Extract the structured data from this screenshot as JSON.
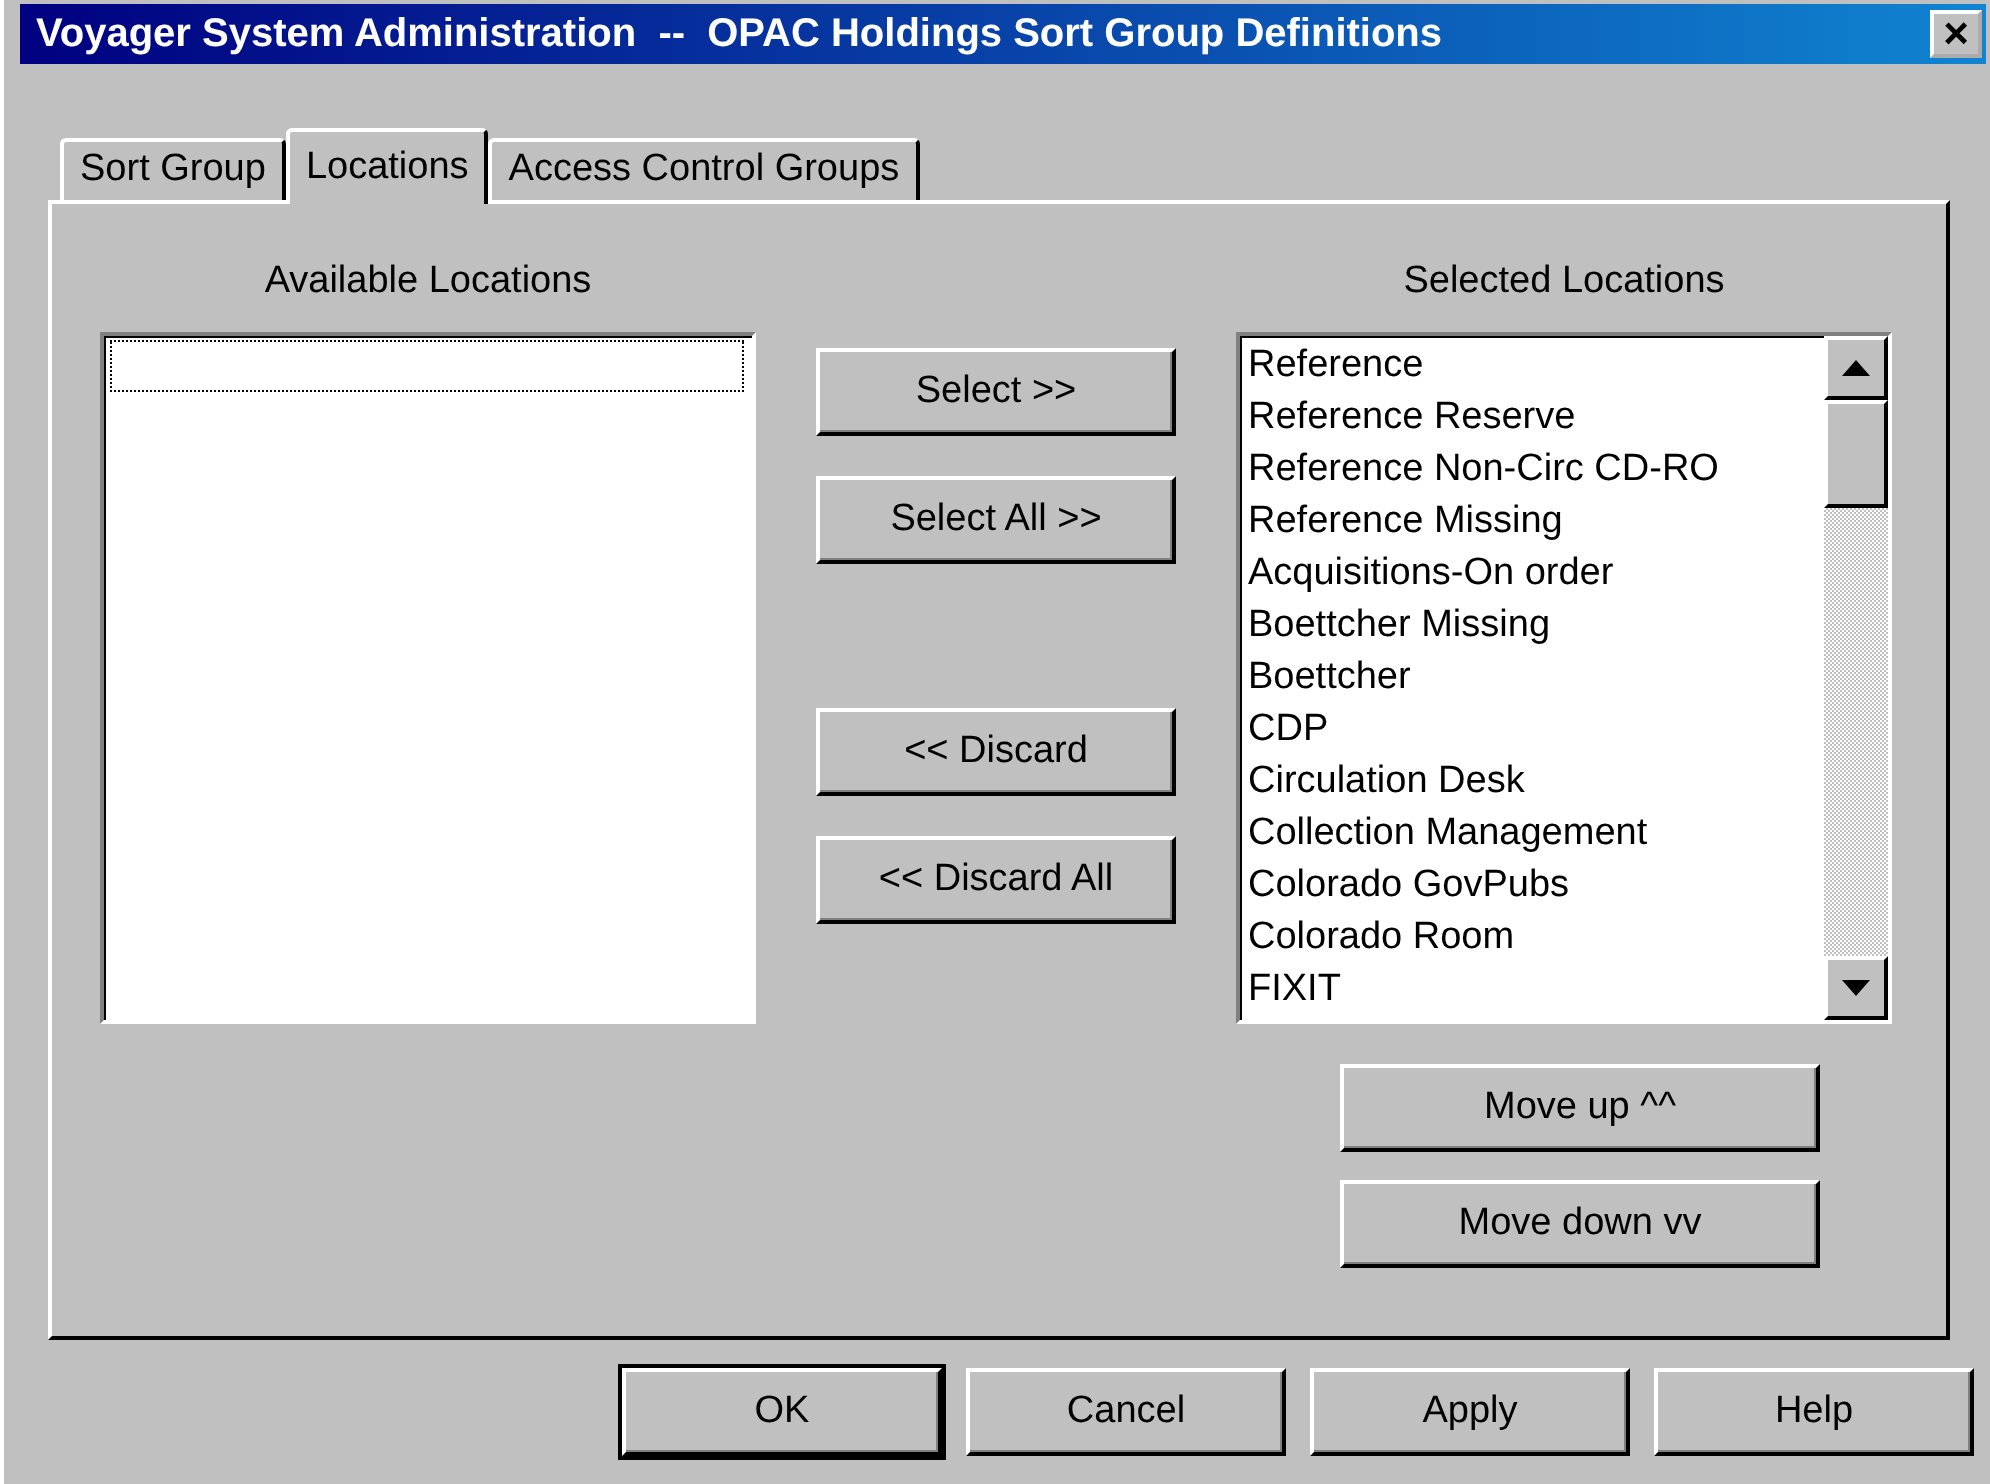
{
  "window": {
    "title": "Voyager System Administration  --  OPAC Holdings Sort Group Definitions",
    "close": "×"
  },
  "tabs": [
    {
      "label": "Sort Group",
      "selected": false
    },
    {
      "label": "Locations",
      "selected": true
    },
    {
      "label": "Access Control Groups",
      "selected": false
    }
  ],
  "available": {
    "label": "Available Locations",
    "focused_empty_row": true
  },
  "transfer_buttons": [
    "Select >>",
    "Select All >>",
    "<< Discard",
    "<< Discard All"
  ],
  "selected": {
    "label": "Selected Locations",
    "items": [
      "Reference",
      "Reference Reserve",
      "Reference Non-Circ CD-RO",
      "Reference Missing",
      "Acquisitions-On order",
      "Boettcher Missing",
      "Boettcher",
      "CDP",
      "Circulation Desk",
      "Collection Management",
      "Colorado GovPubs",
      "Colorado Room",
      "FIXIT"
    ]
  },
  "order_buttons": [
    "Move up ^^",
    "Move down vv"
  ],
  "dialog_buttons": [
    {
      "label": "OK",
      "default": true
    },
    {
      "label": "Cancel",
      "default": false
    },
    {
      "label": "Apply",
      "default": false
    },
    {
      "label": "Help",
      "default": false
    }
  ]
}
